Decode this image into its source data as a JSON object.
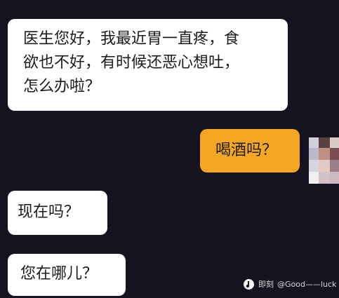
{
  "messages": [
    {
      "sender": "patient",
      "lines": [
        "医生您好，我最近胃一直疼，食",
        "欲也不好，有时候还恶心想吐，",
        "怎么办啦？"
      ]
    },
    {
      "sender": "doctor",
      "text": "喝酒吗？"
    },
    {
      "sender": "patient",
      "text": "现在吗？"
    },
    {
      "sender": "patient",
      "text": "您在哪儿？"
    }
  ],
  "watermark": {
    "app": "即刻",
    "handle": "@Good——luck"
  },
  "colors": {
    "background": "#14131f",
    "incoming_bubble": "#ffffff",
    "outgoing_bubble": "#f5a623"
  }
}
